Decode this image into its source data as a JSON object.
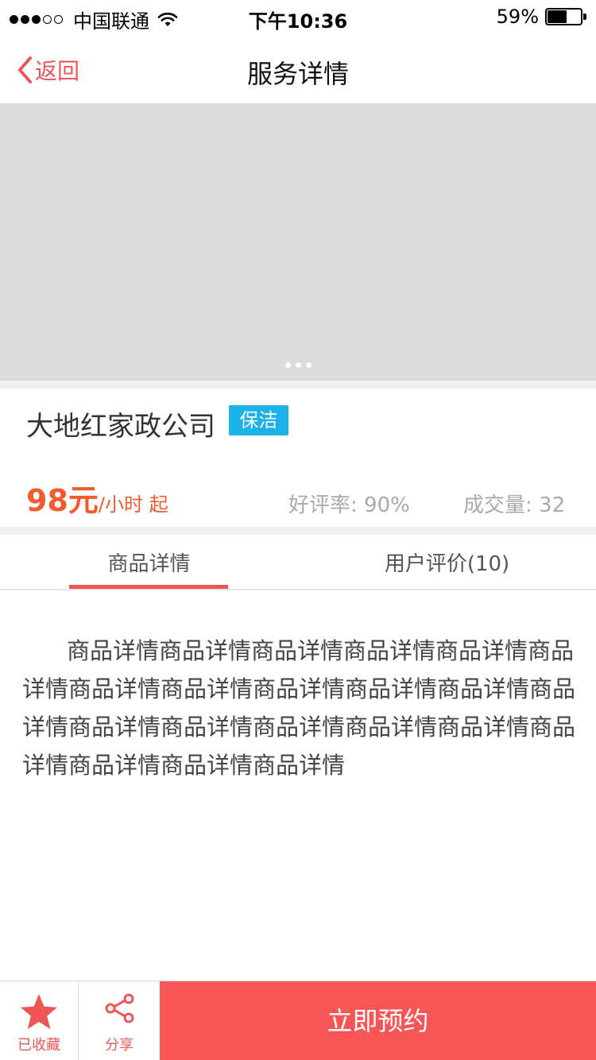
{
  "status_bar": {
    "carrier": "中国联通",
    "time": "下午10:36",
    "battery_percent": "59%",
    "battery_level": 0.59,
    "signal_dots": 5,
    "signal_filled": 3
  },
  "nav": {
    "back_label": "返回",
    "title": "服务详情"
  },
  "banner": {
    "page_count": 3
  },
  "service": {
    "company": "大地红家政公司",
    "tag": "保洁",
    "price_value": "98元",
    "price_unit": "/小时 起",
    "rating": "好评率: 90%",
    "deals": "成交量: 32"
  },
  "tabs": {
    "detail": "商品详情",
    "reviews": "用户评价(10)"
  },
  "content": {
    "detail_text": "商品详情商品详情商品详情商品详情商品详情商品详情商品详情商品详情商品详情商品详情商品详情商品详情商品详情商品详情商品详情商品详情商品详情商品详情商品详情商品详情商品详情"
  },
  "bottom": {
    "favorite_label": "已收藏",
    "share_label": "分享",
    "book_label": "立即预约"
  },
  "colors": {
    "accent": "#f05555",
    "price": "#f25b30",
    "tag": "#1ab2e8",
    "book_button": "#f85656"
  },
  "icons": {
    "back": "chevron-left-icon",
    "favorite": "star-icon",
    "share": "share-icon",
    "wifi": "wifi-icon",
    "battery": "battery-icon"
  }
}
